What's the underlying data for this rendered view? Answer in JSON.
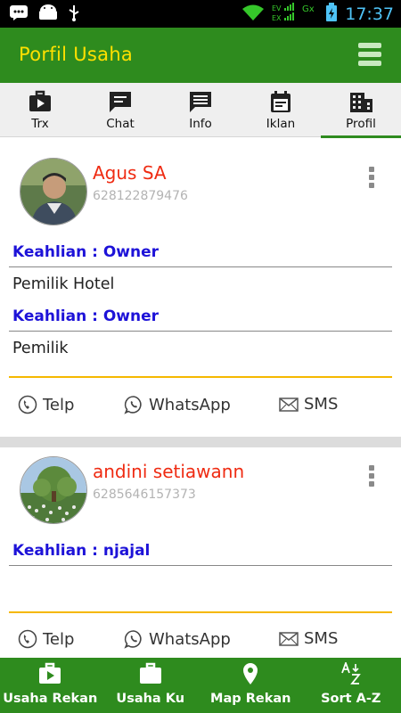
{
  "status_bar": {
    "time": "17:37",
    "left_icons": [
      "bbm-icon",
      "android-icon",
      "usb-icon"
    ],
    "right_icons": [
      "wifi-icon",
      "signal-ev-icon",
      "gx-icon",
      "battery-icon"
    ],
    "signal_label_1": "EV",
    "signal_label_2": "EX",
    "gx_label": "Gx"
  },
  "app_bar": {
    "title": "Porfil Usaha",
    "menu_icon": "hamburger-menu-icon"
  },
  "tabs": [
    {
      "label": "Trx",
      "icon": "video-briefcase-icon",
      "active": false
    },
    {
      "label": "Chat",
      "icon": "chat-bubble-icon",
      "active": false
    },
    {
      "label": "Info",
      "icon": "message-text-icon",
      "active": false
    },
    {
      "label": "Iklan",
      "icon": "calendar-list-icon",
      "active": false
    },
    {
      "label": "Profil",
      "icon": "building-icon",
      "active": true
    }
  ],
  "members": [
    {
      "name": "Agus SA",
      "phone": "628122879476",
      "skills": [
        {
          "label": "Keahlian : Owner",
          "value": "Pemilik Hotel"
        },
        {
          "label": "Keahlian : Owner",
          "value": "Pemilik"
        }
      ],
      "actions": {
        "call": "Telp",
        "whatsapp": "WhatsApp",
        "sms": "SMS"
      }
    },
    {
      "name": "andini setiawann",
      "phone": "6285646157373",
      "skills": [
        {
          "label": "Keahlian : njajal",
          "value": ""
        }
      ],
      "actions": {
        "call": "Telp",
        "whatsapp": "WhatsApp",
        "sms": "SMS"
      }
    }
  ],
  "bottom_nav": [
    {
      "label": "Usaha Rekan",
      "icon": "video-briefcase-icon"
    },
    {
      "label": "Usaha Ku",
      "icon": "briefcase-icon"
    },
    {
      "label": "Map Rekan",
      "icon": "map-pin-icon"
    },
    {
      "label": "Sort A-Z",
      "icon": "sort-az-icon"
    }
  ],
  "colors": {
    "primary": "#2e8b1e",
    "title": "#ffe000",
    "name": "#ef2b12",
    "skill": "#1d12d8",
    "divider_accent": "#f5b800"
  }
}
